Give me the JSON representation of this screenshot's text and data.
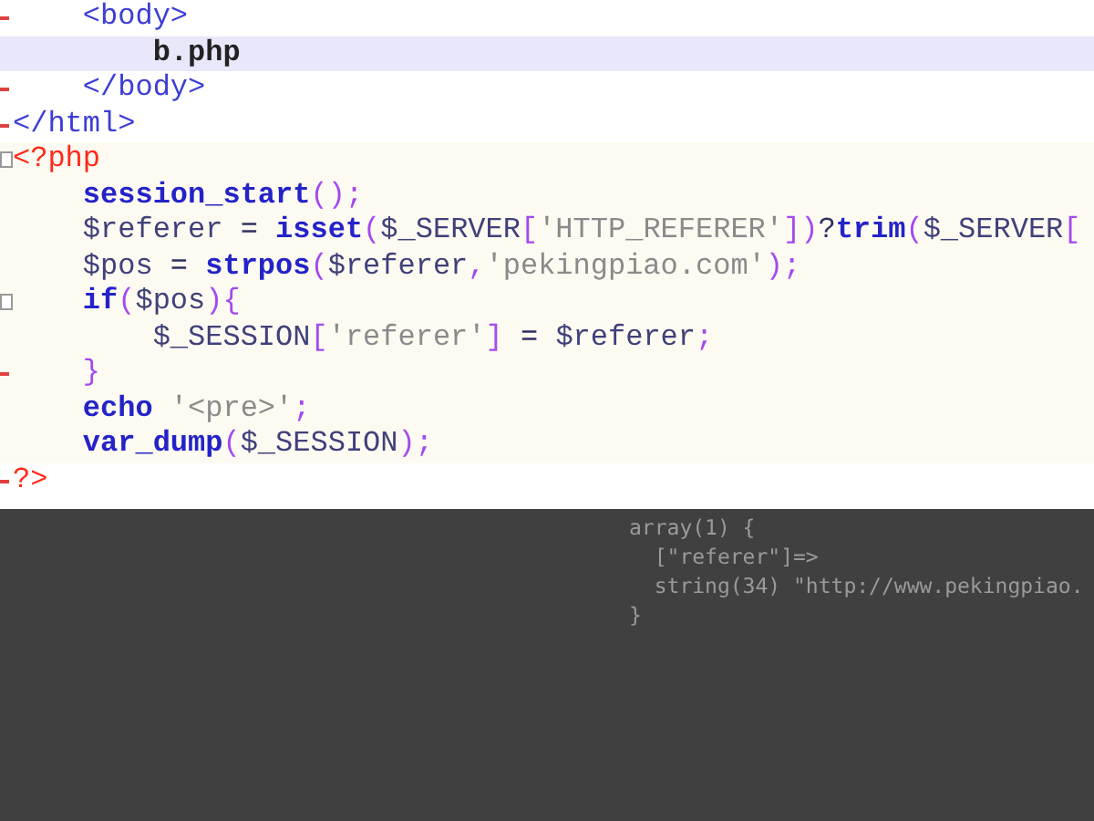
{
  "editor": {
    "lines": [
      {
        "kind": "html",
        "highlighted": false,
        "fold_start": false,
        "fold_end": true,
        "tokens": [
          {
            "kind": "tag",
            "text": "    <body>"
          }
        ]
      },
      {
        "kind": "html",
        "highlighted": true,
        "fold_start": false,
        "fold_end": false,
        "tokens": [
          {
            "kind": "text",
            "text": "        b.php"
          }
        ]
      },
      {
        "kind": "html",
        "highlighted": false,
        "fold_start": false,
        "fold_end": true,
        "tokens": [
          {
            "kind": "tag",
            "text": "    </body>"
          }
        ]
      },
      {
        "kind": "html",
        "highlighted": false,
        "fold_start": false,
        "fold_end": true,
        "tokens": [
          {
            "kind": "tag",
            "text": "</html>"
          }
        ]
      },
      {
        "kind": "php",
        "highlighted": false,
        "fold_start": true,
        "fold_end": false,
        "tokens": [
          {
            "kind": "phptag",
            "text": "<?php"
          }
        ]
      },
      {
        "kind": "php",
        "highlighted": false,
        "fold_start": false,
        "fold_end": false,
        "tokens": [
          {
            "kind": "keyword",
            "text": "    session_start"
          },
          {
            "kind": "punct",
            "text": "();"
          }
        ]
      },
      {
        "kind": "php",
        "highlighted": false,
        "fold_start": false,
        "fold_end": false,
        "tokens": [
          {
            "kind": "variable",
            "text": "    $referer"
          },
          {
            "kind": "op",
            "text": " = "
          },
          {
            "kind": "keyword",
            "text": "isset"
          },
          {
            "kind": "punct",
            "text": "("
          },
          {
            "kind": "variable",
            "text": "$_SERVER"
          },
          {
            "kind": "punct",
            "text": "["
          },
          {
            "kind": "string",
            "text": "'HTTP_REFERER'"
          },
          {
            "kind": "punct",
            "text": "])"
          },
          {
            "kind": "op",
            "text": "?"
          },
          {
            "kind": "keyword",
            "text": "trim"
          },
          {
            "kind": "punct",
            "text": "("
          },
          {
            "kind": "variable",
            "text": "$_SERVER"
          },
          {
            "kind": "punct",
            "text": "["
          }
        ]
      },
      {
        "kind": "php",
        "highlighted": false,
        "fold_start": false,
        "fold_end": false,
        "tokens": [
          {
            "kind": "variable",
            "text": "    $pos"
          },
          {
            "kind": "op",
            "text": " = "
          },
          {
            "kind": "keyword",
            "text": "strpos"
          },
          {
            "kind": "punct",
            "text": "("
          },
          {
            "kind": "variable",
            "text": "$referer"
          },
          {
            "kind": "punct",
            "text": ","
          },
          {
            "kind": "string",
            "text": "'pekingpiao.com'"
          },
          {
            "kind": "punct",
            "text": ");"
          }
        ]
      },
      {
        "kind": "php",
        "highlighted": false,
        "fold_start": true,
        "fold_end": false,
        "tokens": [
          {
            "kind": "keyword",
            "text": "    if"
          },
          {
            "kind": "punct",
            "text": "("
          },
          {
            "kind": "variable",
            "text": "$pos"
          },
          {
            "kind": "punct",
            "text": "){"
          }
        ]
      },
      {
        "kind": "php",
        "highlighted": false,
        "fold_start": false,
        "fold_end": false,
        "tokens": [
          {
            "kind": "variable",
            "text": "        $_SESSION"
          },
          {
            "kind": "punct",
            "text": "["
          },
          {
            "kind": "string",
            "text": "'referer'"
          },
          {
            "kind": "punct",
            "text": "]"
          },
          {
            "kind": "op",
            "text": " = "
          },
          {
            "kind": "variable",
            "text": "$referer"
          },
          {
            "kind": "punct",
            "text": ";"
          }
        ]
      },
      {
        "kind": "php",
        "highlighted": false,
        "fold_start": false,
        "fold_end": true,
        "tokens": [
          {
            "kind": "punct",
            "text": "    }"
          }
        ]
      },
      {
        "kind": "php",
        "highlighted": false,
        "fold_start": false,
        "fold_end": false,
        "tokens": [
          {
            "kind": "keyword",
            "text": "    echo"
          },
          {
            "kind": "string",
            "text": " '<pre>'"
          },
          {
            "kind": "punct",
            "text": ";"
          }
        ]
      },
      {
        "kind": "php",
        "highlighted": false,
        "fold_start": false,
        "fold_end": false,
        "tokens": [
          {
            "kind": "keyword",
            "text": "    var_dump"
          },
          {
            "kind": "punct",
            "text": "("
          },
          {
            "kind": "variable",
            "text": "$_SESSION"
          },
          {
            "kind": "punct",
            "text": ");"
          }
        ]
      },
      {
        "kind": "end",
        "highlighted": false,
        "fold_start": false,
        "fold_end": true,
        "tokens": [
          {
            "kind": "phptag",
            "text": "?>"
          }
        ]
      }
    ]
  },
  "output": {
    "lines": [
      "array(1) {",
      "  [\"referer\"]=>",
      "  string(34) \"http://www.pekingpiao.",
      "}"
    ]
  }
}
